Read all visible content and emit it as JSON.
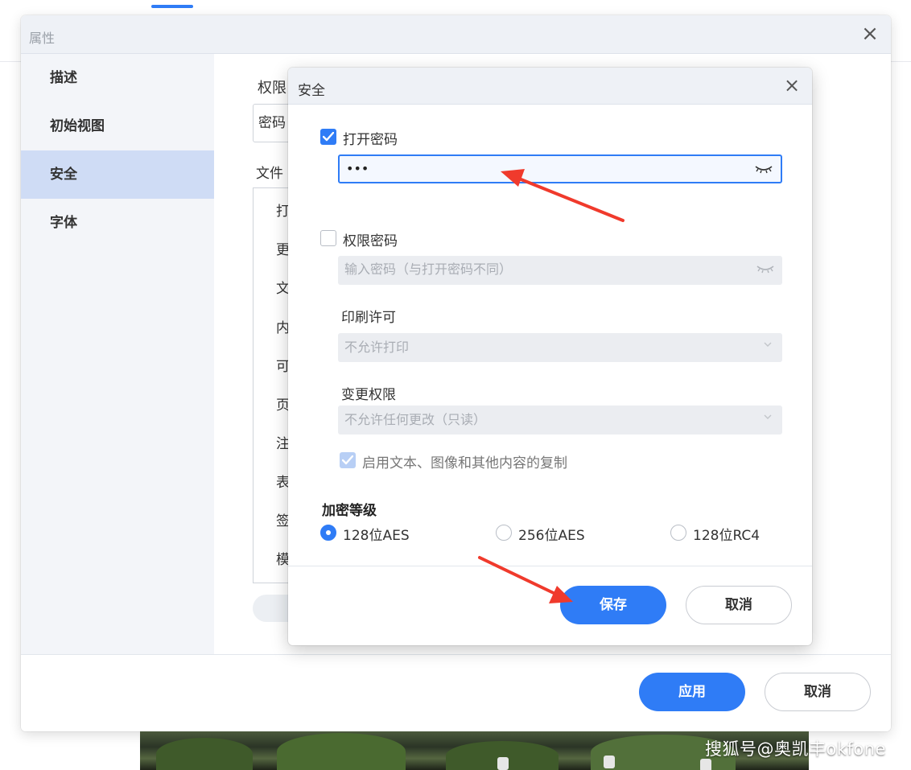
{
  "properties_window": {
    "title": "属性",
    "sidebar": {
      "items": [
        {
          "label": "描述"
        },
        {
          "label": "初始视图"
        },
        {
          "label": "安全"
        },
        {
          "label": "字体"
        }
      ]
    },
    "content": {
      "permission_label": "权限",
      "select_value": "密码",
      "file_label": "文件",
      "list_items": [
        "打",
        "更",
        "文",
        "内",
        "可",
        "页",
        "注",
        "表",
        "签",
        "模"
      ]
    },
    "footer": {
      "apply": "应用",
      "cancel": "取消"
    }
  },
  "security_dialog": {
    "title": "安全",
    "open_password": {
      "label": "打开密码",
      "checked": true,
      "value": "•••"
    },
    "permission_password": {
      "label": "权限密码",
      "checked": false,
      "placeholder": "输入密码（与打开密码不同）"
    },
    "print_permission": {
      "label": "印刷许可",
      "selected": "不允许打印"
    },
    "change_permission": {
      "label": "变更权限",
      "selected": "不允许任何更改（只读）"
    },
    "allow_copy": {
      "label": "启用文本、图像和其他内容的复制",
      "checked": true,
      "disabled": true
    },
    "encryption": {
      "label": "加密等级",
      "options": [
        {
          "label": "128位AES",
          "selected": true
        },
        {
          "label": "256位AES",
          "selected": false
        },
        {
          "label": "128位RC4",
          "selected": false
        }
      ]
    },
    "buttons": {
      "save": "保存",
      "cancel": "取消"
    }
  },
  "watermark": "搜狐号@奥凯丰okfone",
  "colors": {
    "accent": "#2f7cf6",
    "annotation": "#f03a2c",
    "sidebar_active": "#cfdcf5"
  }
}
